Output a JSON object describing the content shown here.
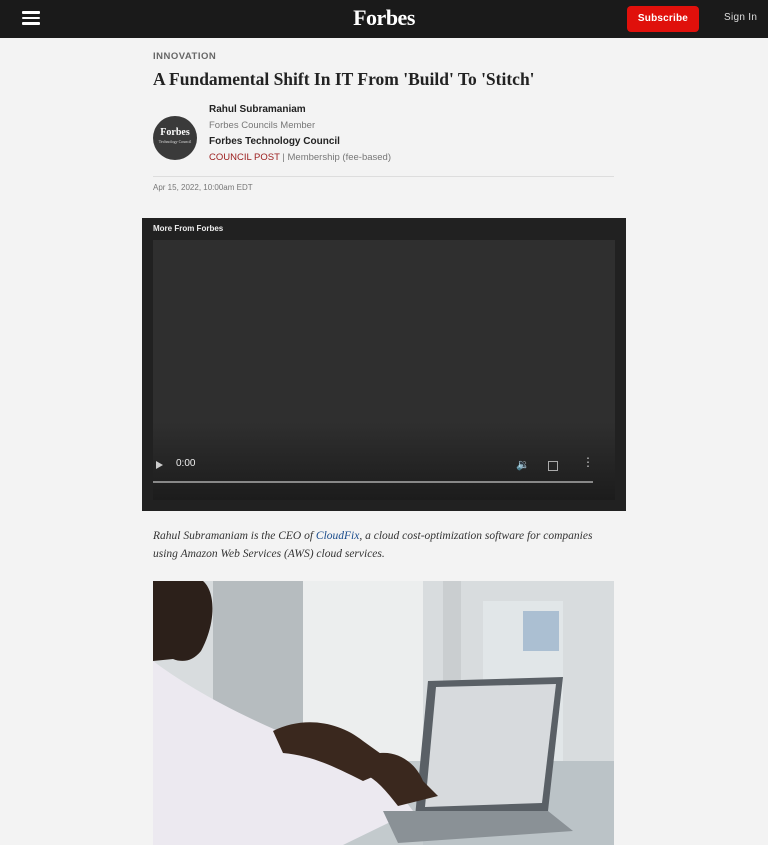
{
  "header": {
    "logo": "Forbes",
    "subscribe_label": "Subscribe",
    "signin_label": "Sign In"
  },
  "article": {
    "section": "INNOVATION",
    "title": "A Fundamental Shift In IT From 'Build' To 'Stitch'",
    "author": {
      "avatar_title": "Forbes",
      "avatar_subtitle": "Technology Council",
      "name": "Rahul Subramaniam",
      "role": "Forbes Councils Member",
      "council": "Forbes Technology Council",
      "post_type": "COUNCIL POST",
      "separator": " | ",
      "membership": "Membership (fee-based)"
    },
    "dateline": "Apr 15, 2022, 10:00am EDT",
    "bio": {
      "prefix": "Rahul Subramaniam is the CEO of ",
      "link": "CloudFix",
      "suffix": ", a cloud cost-optimization software for companies using Amazon Web Services (AWS) cloud services."
    }
  },
  "video": {
    "label": "More From Forbes",
    "time": "0:00",
    "volume_icon": "🔉",
    "more_icon": "⋮"
  },
  "colors": {
    "brand_red": "#e0100b",
    "topbar": "#1a1a1a",
    "link": "#1a4c8c",
    "council_post": "#9b1c1c"
  }
}
